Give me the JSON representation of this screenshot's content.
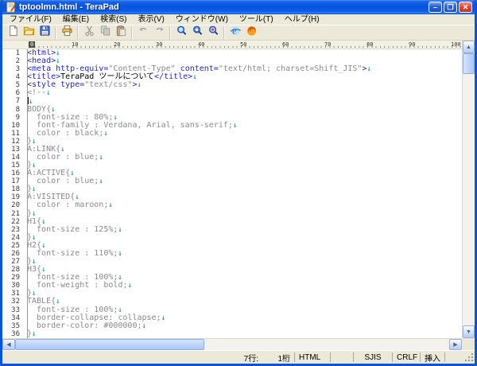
{
  "window": {
    "title": "tptoolmn.html - TeraPad"
  },
  "window_controls": {
    "minimize": "–",
    "maximize": "❐",
    "close": "✕"
  },
  "menu_bar": {
    "items": [
      "ファイル(F)",
      "編集(E)",
      "検索(S)",
      "表示(V)",
      "ウィンドウ(W)",
      "ツール(T)",
      "ヘルプ(H)"
    ]
  },
  "toolbar": {
    "buttons": [
      {
        "name": "new-file",
        "disabled": false
      },
      {
        "name": "open-file",
        "disabled": false
      },
      {
        "name": "save-file",
        "disabled": false
      },
      {
        "sep": true
      },
      {
        "name": "print",
        "disabled": false
      },
      {
        "sep": true
      },
      {
        "name": "cut",
        "disabled": true
      },
      {
        "name": "copy",
        "disabled": true
      },
      {
        "name": "paste",
        "disabled": true
      },
      {
        "sep": true
      },
      {
        "name": "undo",
        "disabled": true
      },
      {
        "name": "redo",
        "disabled": true
      },
      {
        "sep": true
      },
      {
        "name": "find",
        "disabled": false
      },
      {
        "name": "find-next",
        "disabled": false
      },
      {
        "name": "find-prev",
        "disabled": false
      },
      {
        "sep": true
      },
      {
        "name": "ie-browser",
        "disabled": false
      },
      {
        "name": "firefox-browser",
        "disabled": false
      }
    ]
  },
  "ruler": {
    "marks": [
      0,
      10,
      20,
      30,
      40,
      50,
      60,
      70,
      80,
      90,
      100
    ],
    "cursor_mark": 0
  },
  "editor": {
    "eol_mark": "↓",
    "cursor": {
      "line": 7,
      "col": 1
    },
    "lines": [
      {
        "n": 1,
        "segs": [
          {
            "t": "<html>",
            "c": "tag"
          }
        ]
      },
      {
        "n": 2,
        "segs": [
          {
            "t": "<head>",
            "c": "tag"
          }
        ]
      },
      {
        "n": 3,
        "segs": [
          {
            "t": "<meta http-equiv=",
            "c": "tag"
          },
          {
            "t": "\"Content-Type\"",
            "c": "str"
          },
          {
            "t": " content=",
            "c": "tag"
          },
          {
            "t": "\"text/html; charset=Shift_JIS\"",
            "c": "str"
          },
          {
            "t": ">",
            "c": "tag"
          }
        ]
      },
      {
        "n": 4,
        "segs": [
          {
            "t": "<title>",
            "c": "tag"
          },
          {
            "t": "TeraPad ツールについて",
            "c": "txt"
          },
          {
            "t": "</title>",
            "c": "tag"
          }
        ]
      },
      {
        "n": 5,
        "segs": [
          {
            "t": "<style type=",
            "c": "tag"
          },
          {
            "t": "\"text/css\"",
            "c": "str"
          },
          {
            "t": ">",
            "c": "tag"
          }
        ]
      },
      {
        "n": 6,
        "segs": [
          {
            "t": "<!--",
            "c": "cmt"
          }
        ]
      },
      {
        "n": 7,
        "segs": []
      },
      {
        "n": 8,
        "segs": [
          {
            "t": "BODY{",
            "c": "cmt"
          }
        ]
      },
      {
        "n": 9,
        "segs": [
          {
            "t": "  font-size : 80%;",
            "c": "cmt"
          }
        ]
      },
      {
        "n": 10,
        "segs": [
          {
            "t": "  font-family : Verdana, Arial, sans-serif;",
            "c": "cmt"
          }
        ]
      },
      {
        "n": 11,
        "segs": [
          {
            "t": "  color : black;",
            "c": "cmt"
          }
        ]
      },
      {
        "n": 12,
        "segs": [
          {
            "t": "}",
            "c": "cmt"
          }
        ]
      },
      {
        "n": 13,
        "segs": [
          {
            "t": "A:LINK{",
            "c": "cmt"
          }
        ]
      },
      {
        "n": 14,
        "segs": [
          {
            "t": "  color : blue;",
            "c": "cmt"
          }
        ]
      },
      {
        "n": 15,
        "segs": [
          {
            "t": "}",
            "c": "cmt"
          }
        ]
      },
      {
        "n": 16,
        "segs": [
          {
            "t": "A:ACTIVE{",
            "c": "cmt"
          }
        ]
      },
      {
        "n": 17,
        "segs": [
          {
            "t": "  color : blue;",
            "c": "cmt"
          }
        ]
      },
      {
        "n": 18,
        "segs": [
          {
            "t": "}",
            "c": "cmt"
          }
        ]
      },
      {
        "n": 19,
        "segs": [
          {
            "t": "A:VISITED{",
            "c": "cmt"
          }
        ]
      },
      {
        "n": 20,
        "segs": [
          {
            "t": "  color : maroon;",
            "c": "cmt"
          }
        ]
      },
      {
        "n": 21,
        "segs": [
          {
            "t": "}",
            "c": "cmt"
          }
        ]
      },
      {
        "n": 22,
        "segs": [
          {
            "t": "H1{",
            "c": "cmt"
          }
        ]
      },
      {
        "n": 23,
        "segs": [
          {
            "t": "  font-size : 125%;",
            "c": "cmt"
          }
        ]
      },
      {
        "n": 24,
        "segs": [
          {
            "t": "}",
            "c": "cmt"
          }
        ]
      },
      {
        "n": 25,
        "segs": [
          {
            "t": "H2{",
            "c": "cmt"
          }
        ]
      },
      {
        "n": 26,
        "segs": [
          {
            "t": "  font-size : 110%;",
            "c": "cmt"
          }
        ]
      },
      {
        "n": 27,
        "segs": [
          {
            "t": "}",
            "c": "cmt"
          }
        ]
      },
      {
        "n": 28,
        "segs": [
          {
            "t": "H3{",
            "c": "cmt"
          }
        ]
      },
      {
        "n": 29,
        "segs": [
          {
            "t": "  font-size : 100%;",
            "c": "cmt"
          }
        ]
      },
      {
        "n": 30,
        "segs": [
          {
            "t": "  font-weight : bold;",
            "c": "cmt"
          }
        ]
      },
      {
        "n": 31,
        "segs": [
          {
            "t": "}",
            "c": "cmt"
          }
        ]
      },
      {
        "n": 32,
        "segs": [
          {
            "t": "TABLE{",
            "c": "cmt"
          }
        ]
      },
      {
        "n": 33,
        "segs": [
          {
            "t": "  font-size : 100%;",
            "c": "cmt"
          }
        ]
      },
      {
        "n": 34,
        "segs": [
          {
            "t": "  border-collapse: collapse;",
            "c": "cmt"
          }
        ]
      },
      {
        "n": 35,
        "segs": [
          {
            "t": "  border-color: #000000;",
            "c": "cmt"
          }
        ]
      },
      {
        "n": 36,
        "segs": [
          {
            "t": "}",
            "c": "cmt"
          }
        ]
      }
    ]
  },
  "statusbar": {
    "cursor_line": "7行:",
    "cursor_column": "1桁",
    "file_type": "HTML",
    "encoding": "SJIS",
    "line_ending": "CRLF",
    "input_mode": "挿入"
  },
  "colors": {
    "tag": "#2525c8",
    "string": "#8a8a8a",
    "comment": "#8a8a8a",
    "text": "#000000",
    "eol_mark": "#008080",
    "titlebar": "#0853dd",
    "chrome": "#ece9d8"
  }
}
